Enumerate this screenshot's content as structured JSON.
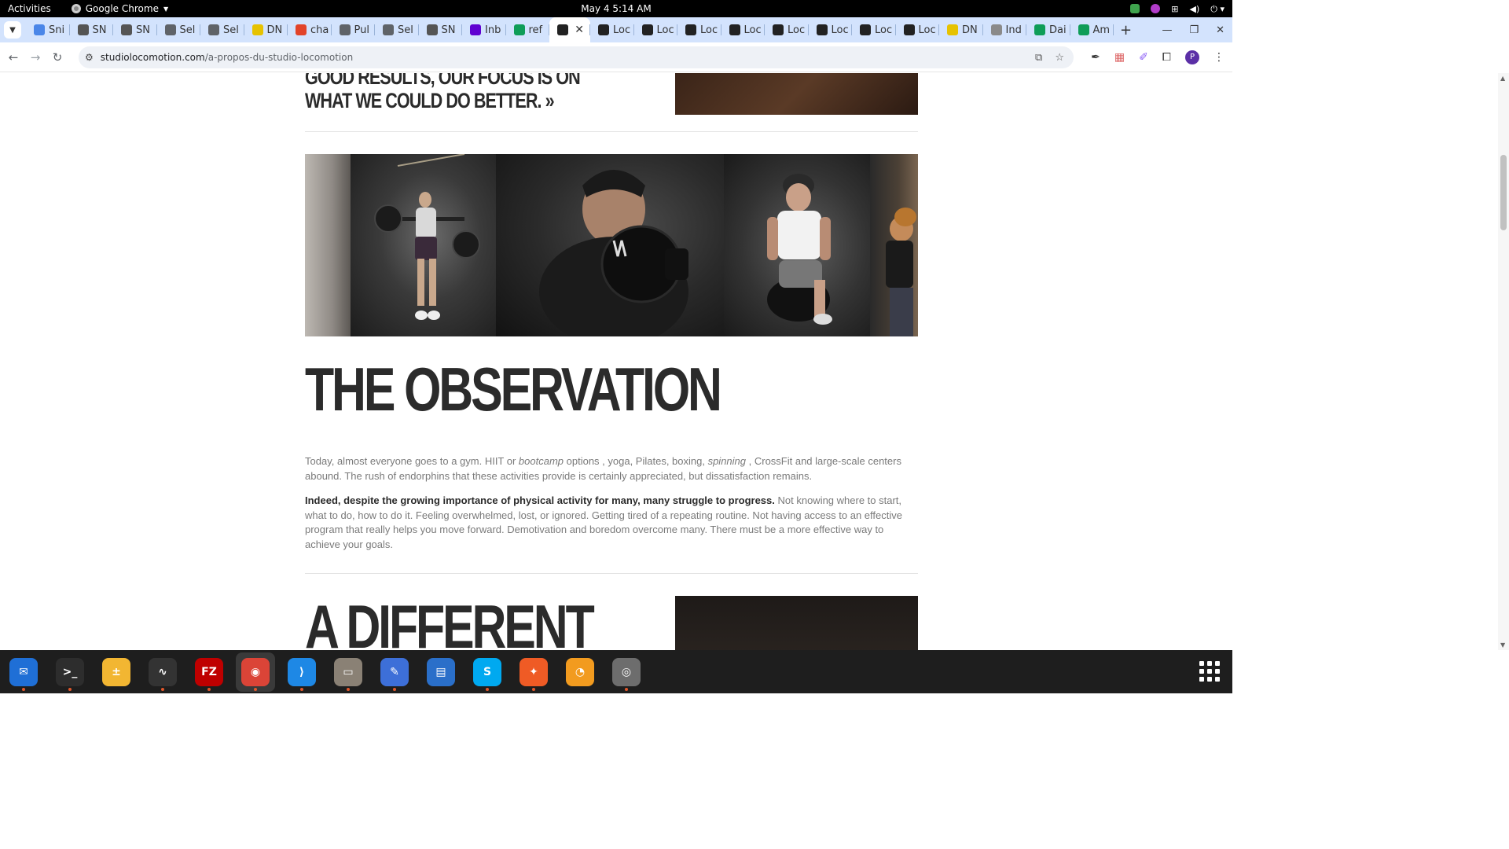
{
  "system": {
    "activities": "Activities",
    "app_name": "Google Chrome",
    "clock": "May 4  5:14 AM"
  },
  "tabs": [
    {
      "label": "Sni",
      "icon": "docs-icon",
      "color": "#4a86e8"
    },
    {
      "label": "SN",
      "icon": "snp-icon",
      "color": "#555555"
    },
    {
      "label": "SN",
      "icon": "snp-icon",
      "color": "#555555"
    },
    {
      "label": "Sel",
      "icon": "globe-icon",
      "color": "#5f6368"
    },
    {
      "label": "Sel",
      "icon": "globe-icon",
      "color": "#5f6368"
    },
    {
      "label": "DN",
      "icon": "smiley-icon",
      "color": "#e6c200"
    },
    {
      "label": "cha",
      "icon": "gitlab-icon",
      "color": "#e24329"
    },
    {
      "label": "Pul",
      "icon": "globe-icon",
      "color": "#5f6368"
    },
    {
      "label": "Sel",
      "icon": "globe-icon",
      "color": "#5f6368"
    },
    {
      "label": "SN",
      "icon": "snp-icon",
      "color": "#555555"
    },
    {
      "label": "Inb",
      "icon": "yahoo-icon",
      "color": "#5f01d1"
    },
    {
      "label": "ref",
      "icon": "sheets-icon",
      "color": "#0f9d58"
    },
    {
      "label": "",
      "icon": "locomotion-icon",
      "color": "#222222",
      "active": true
    },
    {
      "label": "Loc",
      "icon": "locomotion-icon",
      "color": "#222222"
    },
    {
      "label": "Loc",
      "icon": "locomotion-icon",
      "color": "#222222"
    },
    {
      "label": "Loc",
      "icon": "locomotion-icon",
      "color": "#222222"
    },
    {
      "label": "Loc",
      "icon": "locomotion-icon",
      "color": "#222222"
    },
    {
      "label": "Loc",
      "icon": "locomotion-icon",
      "color": "#222222"
    },
    {
      "label": "Loc",
      "icon": "locomotion-icon",
      "color": "#222222"
    },
    {
      "label": "Loc",
      "icon": "locomotion-icon",
      "color": "#222222"
    },
    {
      "label": "Loc",
      "icon": "locomotion-icon",
      "color": "#222222"
    },
    {
      "label": "DN",
      "icon": "smiley-icon",
      "color": "#e6c200"
    },
    {
      "label": "Ind",
      "icon": "doc-icon",
      "color": "#8a8a8a"
    },
    {
      "label": "Dai",
      "icon": "sheets-icon",
      "color": "#0f9d58"
    },
    {
      "label": "Am",
      "icon": "sheets-icon",
      "color": "#0f9d58"
    }
  ],
  "address": {
    "domain": "studiolocomotion.com",
    "path": "/a-propos-du-studio-locomotion"
  },
  "page": {
    "quote": "GOOD RESULTS, OUR FOCUS IS ON WHAT WE COULD DO BETTER. »",
    "heading": "THE OBSERVATION",
    "para1_a": "Today, almost everyone goes to a gym. HIIT or ",
    "para1_em1": "bootcamp",
    "para1_b": " options , yoga, Pilates, boxing, ",
    "para1_em2": "spinning",
    "para1_c": " , CrossFit and large-scale centers abound. The rush of endorphins that these activities provide is certainly appreciated, but dissatisfaction remains.",
    "para2_strong": "Indeed, despite the growing importance of physical activity for many, many struggle to progress.",
    "para2_rest": " Not knowing where to start, what to do, how to do it. Feeling overwhelmed, lost, or ignored. Getting tired of a repeating routine. Not having access to an effective program that really helps you move forward. Demotivation and boredom overcome many. There must be a more effective way to achieve your goals.",
    "heading2": "A DIFFERENT"
  },
  "dock": [
    {
      "name": "thunderbird-icon",
      "color": "#1f6fd6",
      "glyph": "✉",
      "dot": true
    },
    {
      "name": "terminal-icon",
      "color": "#2d2d2d",
      "glyph": ">_",
      "dot": true
    },
    {
      "name": "calculator-icon",
      "color": "#f2b632",
      "glyph": "±",
      "dot": false
    },
    {
      "name": "system-monitor-icon",
      "color": "#333333",
      "glyph": "∿",
      "dot": true
    },
    {
      "name": "filezilla-icon",
      "color": "#bf0000",
      "glyph": "FZ",
      "dot": true
    },
    {
      "name": "chrome-icon",
      "color": "#db4437",
      "glyph": "◉",
      "dot": true,
      "active": true
    },
    {
      "name": "vscode-icon",
      "color": "#1e88e5",
      "glyph": "⟩",
      "dot": true
    },
    {
      "name": "files-icon",
      "color": "#8a8175",
      "glyph": "▭",
      "dot": true
    },
    {
      "name": "text-editor-icon",
      "color": "#3d6fd8",
      "glyph": "✎",
      "dot": true
    },
    {
      "name": "libreoffice-writer-icon",
      "color": "#2a6fc9",
      "glyph": "▤",
      "dot": false
    },
    {
      "name": "skype-icon",
      "color": "#00a9f0",
      "glyph": "S",
      "dot": true
    },
    {
      "name": "postman-icon",
      "color": "#ef5b25",
      "glyph": "✦",
      "dot": true
    },
    {
      "name": "hotspot-icon",
      "color": "#f29b1f",
      "glyph": "◔",
      "dot": false
    },
    {
      "name": "disk-icon",
      "color": "#6d6d6d",
      "glyph": "◎",
      "dot": true
    }
  ]
}
